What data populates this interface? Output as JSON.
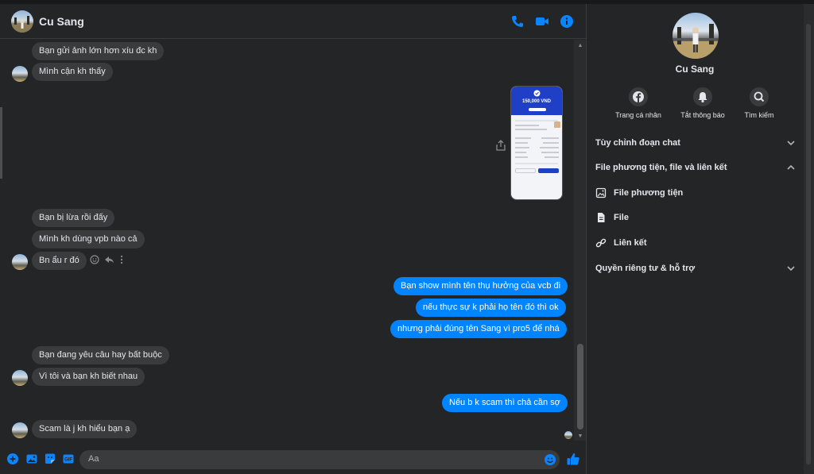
{
  "header": {
    "contact_name": "Cu Sang"
  },
  "messages": {
    "m1": "Bạn gửi ảnh lớn hơn xíu đc kh",
    "m2": "Mình cận kh thấy",
    "m3": "Bạn bị lừa rồi đấy",
    "m4": "Mình kh dùng vpb nào cả",
    "m5": "Bn ẩu r đó",
    "m6": "Bạn show mình tên thụ hưởng của vcb đi",
    "m7": "nếu thực sự k phải họ tên đó thì ok",
    "m8": "nhưng phải đúng tên Sang vì pro5 để nhá",
    "m9": "Bạn đang yêu câu hay bất buộc",
    "m10": "Vì tôi và bạn kh biết nhau",
    "m11": "Nếu b k scam thì chả cần sợ",
    "m12": "Scam là j kh hiểu bạn ạ"
  },
  "image_message": {
    "amount": "150,000 VND"
  },
  "composer": {
    "placeholder": "Aa"
  },
  "panel": {
    "name": "Cu Sang",
    "actions": {
      "profile": "Trang cá nhân",
      "mute": "Tắt thông báo",
      "search": "Tìm kiếm"
    },
    "sections": {
      "customize": "Tùy chỉnh đoạn chat",
      "media_files_links": "File phương tiện, file và liên kết",
      "media": "File phương tiện",
      "files": "File",
      "links": "Liên kết",
      "privacy": "Quyền riêng tư & hỗ trợ"
    }
  },
  "colors": {
    "accent": "#0084ff",
    "background": "#242526",
    "received_bubble": "#3a3b3c"
  }
}
